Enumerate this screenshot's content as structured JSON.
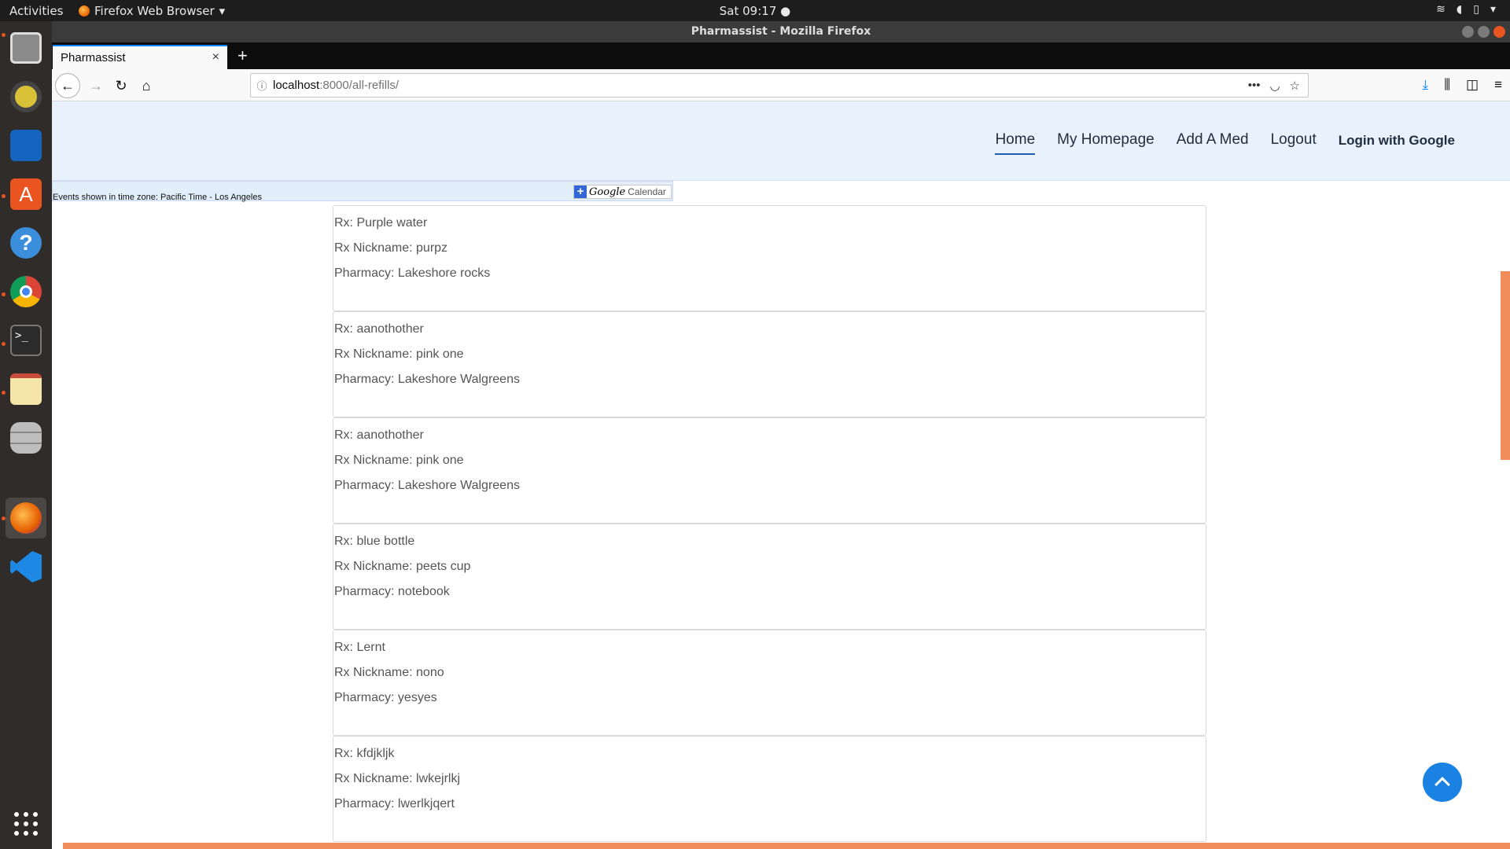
{
  "os": {
    "activities": "Activities",
    "app_menu": "Firefox Web Browser",
    "clock": "Sat 09:17",
    "tray": [
      "wifi-icon",
      "volume-icon",
      "battery-icon",
      "power-menu-icon"
    ]
  },
  "dock": {
    "items": [
      {
        "name": "files",
        "icon": "file-cabinet-icon",
        "color": "#8b8b8b"
      },
      {
        "name": "rhythmbox",
        "icon": "speaker-icon",
        "color": "#d9c237"
      },
      {
        "name": "writer",
        "icon": "document-icon",
        "color": "#1565c0"
      },
      {
        "name": "software",
        "icon": "shopping-bag-icon",
        "color": "#e95420"
      },
      {
        "name": "help",
        "icon": "question-icon",
        "color": "#3b8edb"
      },
      {
        "name": "chrome",
        "icon": "chrome-icon",
        "color": "#4caf50"
      },
      {
        "name": "terminal",
        "icon": "terminal-icon",
        "color": "#2b2b2b"
      },
      {
        "name": "text-editor",
        "icon": "notepad-icon",
        "color": "#f5e5a8"
      },
      {
        "name": "database",
        "icon": "database-icon",
        "color": "#9e9e9e"
      },
      {
        "name": "firefox",
        "icon": "firefox-icon",
        "color": "#e66000"
      },
      {
        "name": "vscode",
        "icon": "vscode-icon",
        "color": "#1e88e5"
      }
    ],
    "show_apps": "apps-grid-icon"
  },
  "window": {
    "title": "Pharmassist - Mozilla Firefox",
    "tab_title": "Pharmassist",
    "url_host": "localhost",
    "url_rest": ":8000/all-refills/",
    "new_tab": "+",
    "tab_close": "×"
  },
  "site": {
    "nav": [
      {
        "label": "Home",
        "active": true
      },
      {
        "label": "My Homepage"
      },
      {
        "label": "Add A Med"
      },
      {
        "label": "Logout"
      },
      {
        "label": "Login with Google"
      }
    ],
    "calendar": {
      "timezone_text": "Events shown in time zone: Pacific Time - Los Angeles",
      "plus": "+",
      "google_word": "Google",
      "calendar_word": "Calendar"
    },
    "refills": [
      {
        "rx": "Rx: Purple water",
        "nickname": "Rx Nickname: purpz",
        "pharmacy": "Pharmacy: Lakeshore rocks"
      },
      {
        "rx": "Rx: aanothother",
        "nickname": "Rx Nickname: pink one",
        "pharmacy": "Pharmacy: Lakeshore Walgreens"
      },
      {
        "rx": "Rx: aanothother",
        "nickname": "Rx Nickname: pink one",
        "pharmacy": "Pharmacy: Lakeshore Walgreens"
      },
      {
        "rx": "Rx: blue bottle",
        "nickname": "Rx Nickname: peets cup",
        "pharmacy": "Pharmacy: notebook"
      },
      {
        "rx": "Rx: Lernt",
        "nickname": "Rx Nickname: nono",
        "pharmacy": "Pharmacy: yesyes"
      },
      {
        "rx": "Rx: kfdjkljk",
        "nickname": "Rx Nickname: lwkejrlkj",
        "pharmacy": "Pharmacy: lwerlkjqert"
      }
    ]
  },
  "colors": {
    "accent": "#e95420",
    "header_bg": "#e8f1fc",
    "back_to_top": "#1a82e2"
  }
}
